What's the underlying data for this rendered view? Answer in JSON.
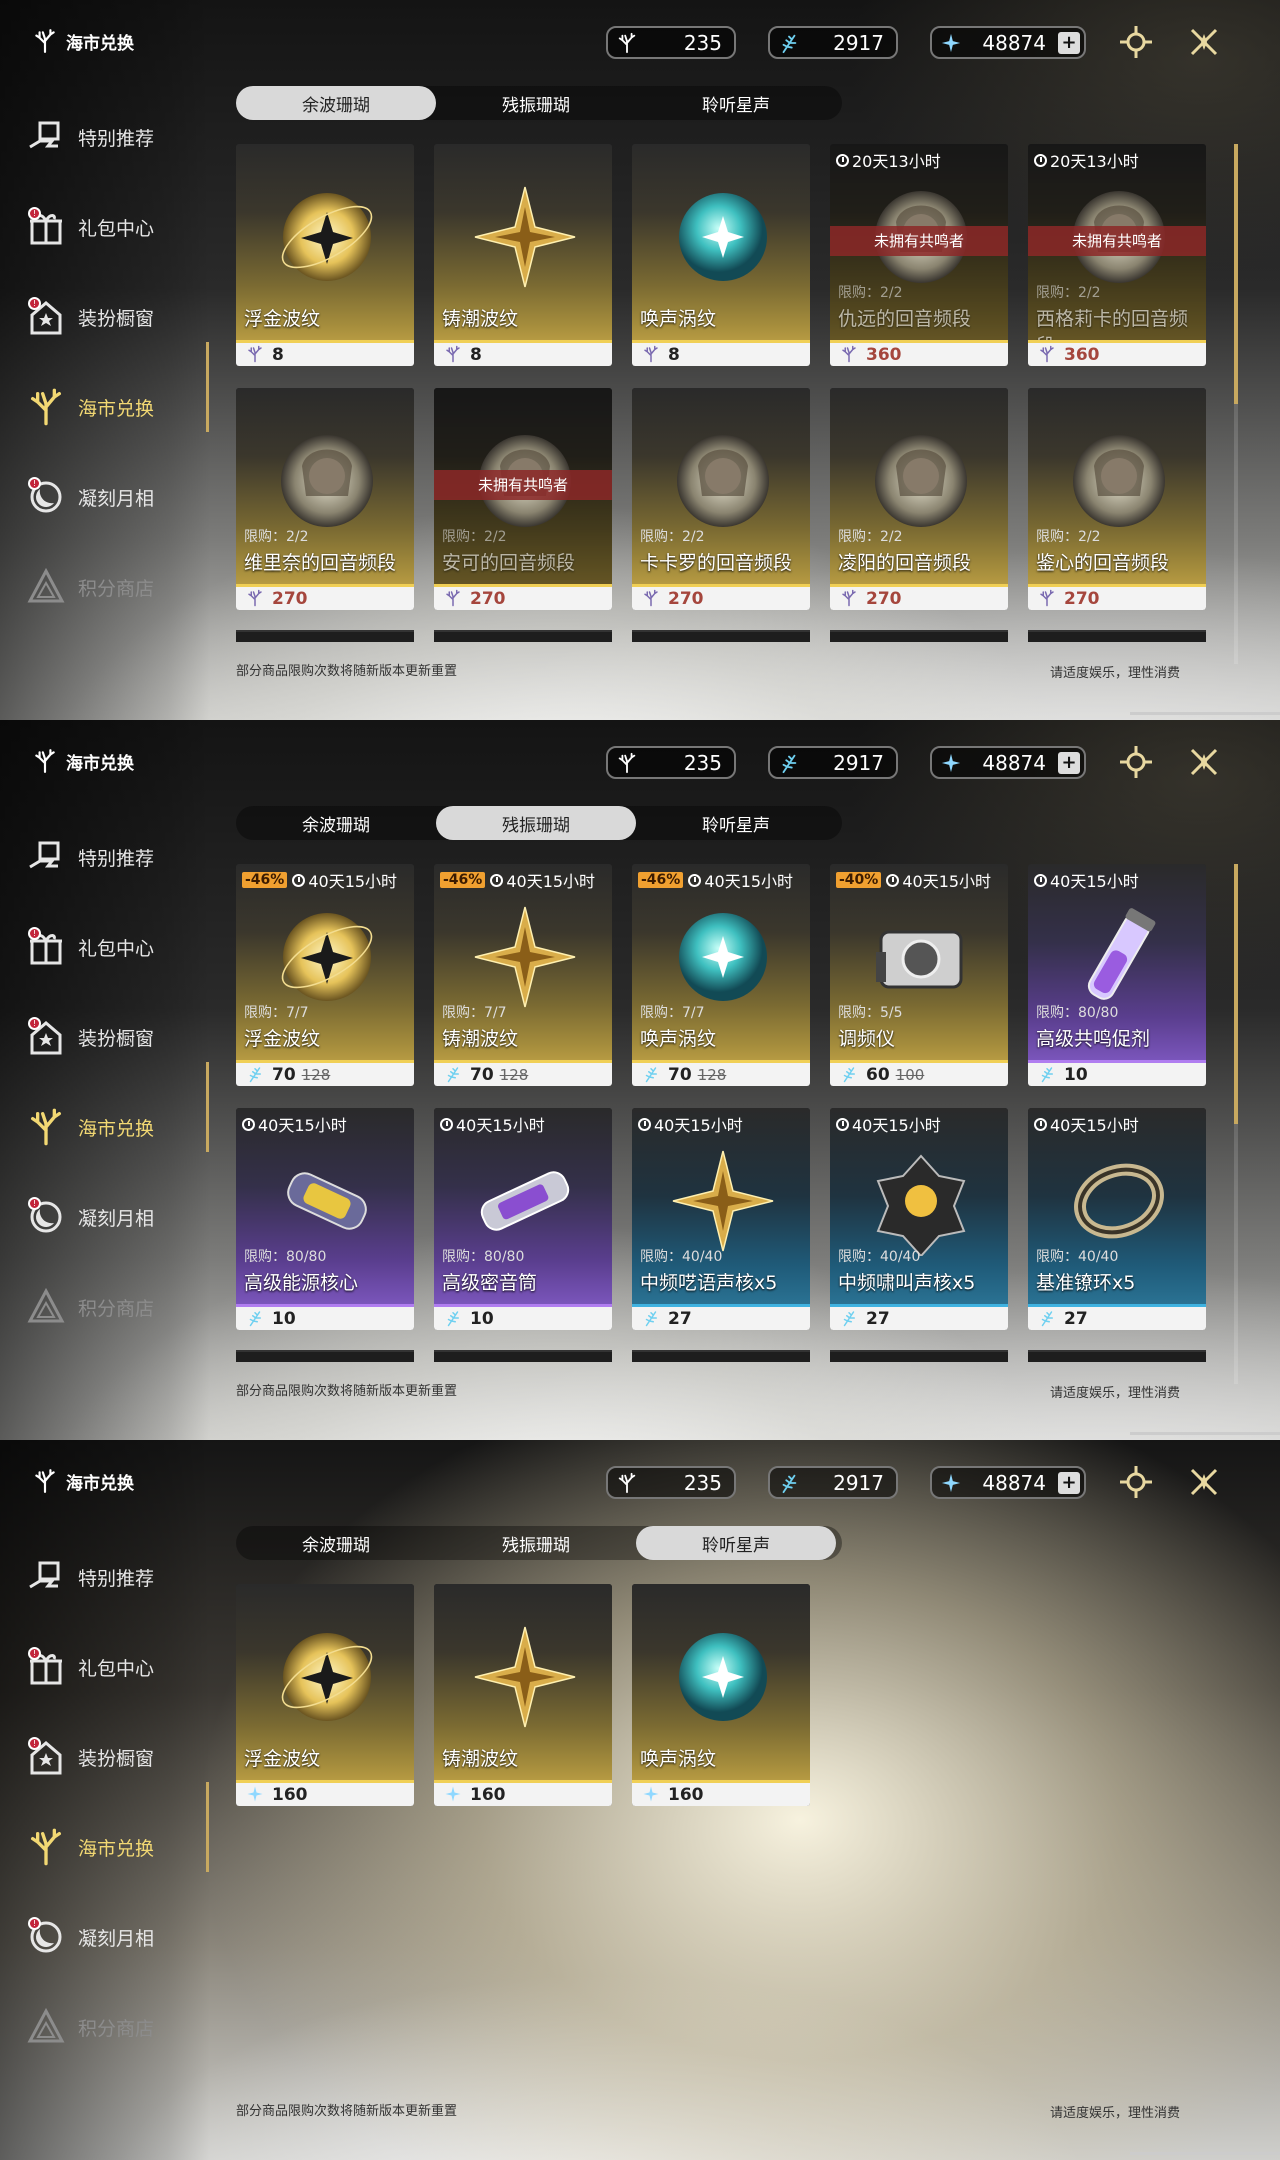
{
  "sidebar": {
    "brand": "海市兑换",
    "items": [
      {
        "label": "特别推荐",
        "icon": "gift-hand-icon",
        "badge": false,
        "dim": false
      },
      {
        "label": "礼包中心",
        "icon": "gift-box-icon",
        "badge": true,
        "dim": false
      },
      {
        "label": "装扮橱窗",
        "icon": "house-star-icon",
        "badge": true,
        "dim": false
      },
      {
        "label": "海市兑换",
        "icon": "coral-icon",
        "badge": false,
        "dim": false
      },
      {
        "label": "凝刻月相",
        "icon": "moon-crest-icon",
        "badge": true,
        "dim": false
      },
      {
        "label": "积分商店",
        "icon": "triangle-icon",
        "badge": false,
        "dim": true
      }
    ]
  },
  "currencies": [
    {
      "name": "afterglow-coral",
      "value": "235",
      "icon": "coral-feather-icon"
    },
    {
      "name": "oscillated-coral",
      "value": "2917",
      "icon": "coral-feather-blue-icon"
    },
    {
      "name": "star-sound",
      "value": "48874",
      "icon": "star-icon",
      "plus": "+"
    }
  ],
  "tabs": [
    "余波珊瑚",
    "残振珊瑚",
    "聆听星声"
  ],
  "footer": {
    "left": "部分商品限购次数将随新版本更新重置",
    "right": "请适度娱乐，理性消费"
  },
  "panels": [
    {
      "active_tab": 0,
      "cards": [
        {
          "name": "浮金波纹",
          "price": "8",
          "style": "gold",
          "art": "gold-orb"
        },
        {
          "name": "铸潮波纹",
          "price": "8",
          "style": "gold",
          "art": "gold-star"
        },
        {
          "name": "唤声涡纹",
          "price": "8",
          "style": "gold",
          "art": "teal-orb"
        },
        {
          "name": "仇远的回音频段",
          "price": "360",
          "style": "gold",
          "art": "portrait",
          "timer": "20天13小时",
          "limit": "限购：2/2",
          "owned": "未拥有共鸣者",
          "dim": true,
          "red": true
        },
        {
          "name": "西格莉卡的回音频段",
          "price": "360",
          "style": "gold",
          "art": "portrait",
          "timer": "20天13小时",
          "limit": "限购：2/2",
          "owned": "未拥有共鸣者",
          "dim": true,
          "red": true
        },
        {
          "name": "维里奈的回音频段",
          "price": "270",
          "style": "gold",
          "art": "portrait",
          "limit": "限购：2/2",
          "red": true
        },
        {
          "name": "安可的回音频段",
          "price": "270",
          "style": "gold",
          "art": "portrait",
          "limit": "限购：2/2",
          "owned": "未拥有共鸣者",
          "dim": true,
          "red": true
        },
        {
          "name": "卡卡罗的回音频段",
          "price": "270",
          "style": "gold",
          "art": "portrait",
          "limit": "限购：2/2",
          "red": true
        },
        {
          "name": "凌阳的回音频段",
          "price": "270",
          "style": "gold",
          "art": "portrait",
          "limit": "限购：2/2",
          "red": true
        },
        {
          "name": "鉴心的回音频段",
          "price": "270",
          "style": "gold",
          "art": "portrait",
          "limit": "限购：2/2",
          "red": true
        }
      ]
    },
    {
      "active_tab": 1,
      "cards": [
        {
          "name": "浮金波纹",
          "price": "70",
          "old": "128",
          "style": "gold",
          "art": "gold-orb",
          "disc": "-46%",
          "timer": "40天15小时",
          "limit": "限购：7/7"
        },
        {
          "name": "铸潮波纹",
          "price": "70",
          "old": "128",
          "style": "gold",
          "art": "gold-star",
          "disc": "-46%",
          "timer": "40天15小时",
          "limit": "限购：7/7"
        },
        {
          "name": "唤声涡纹",
          "price": "70",
          "old": "128",
          "style": "gold",
          "art": "teal-orb",
          "disc": "-46%",
          "timer": "40天15小时",
          "limit": "限购：7/7"
        },
        {
          "name": "调频仪",
          "price": "60",
          "old": "100",
          "style": "gold",
          "art": "device",
          "disc": "-40%",
          "timer": "40天15小时",
          "limit": "限购：5/5"
        },
        {
          "name": "高级共鸣促剂",
          "price": "10",
          "style": "purple",
          "art": "vial",
          "timer": "40天15小时",
          "limit": "限购：80/80"
        },
        {
          "name": "高级能源核心",
          "price": "10",
          "style": "purple",
          "art": "capsule",
          "timer": "40天15小时",
          "limit": "限购：80/80"
        },
        {
          "name": "高级密音筒",
          "price": "10",
          "style": "purple",
          "art": "tube",
          "timer": "40天15小时",
          "limit": "限购：80/80"
        },
        {
          "name": "中频呓语声核x5",
          "price": "27",
          "style": "blue",
          "art": "gold-star",
          "timer": "40天15小时",
          "limit": "限购：40/40"
        },
        {
          "name": "中频啸叫声核x5",
          "price": "27",
          "style": "blue",
          "art": "dark-core",
          "timer": "40天15小时",
          "limit": "限购：40/40"
        },
        {
          "name": "基准镣环x5",
          "price": "27",
          "style": "blue",
          "art": "ring",
          "timer": "40天15小时",
          "limit": "限购：40/40"
        }
      ]
    },
    {
      "active_tab": 2,
      "cards": [
        {
          "name": "浮金波纹",
          "price": "160",
          "style": "gold",
          "art": "gold-orb"
        },
        {
          "name": "铸潮波纹",
          "price": "160",
          "style": "gold",
          "art": "gold-star"
        },
        {
          "name": "唤声涡纹",
          "price": "160",
          "style": "gold",
          "art": "teal-orb"
        }
      ]
    }
  ]
}
